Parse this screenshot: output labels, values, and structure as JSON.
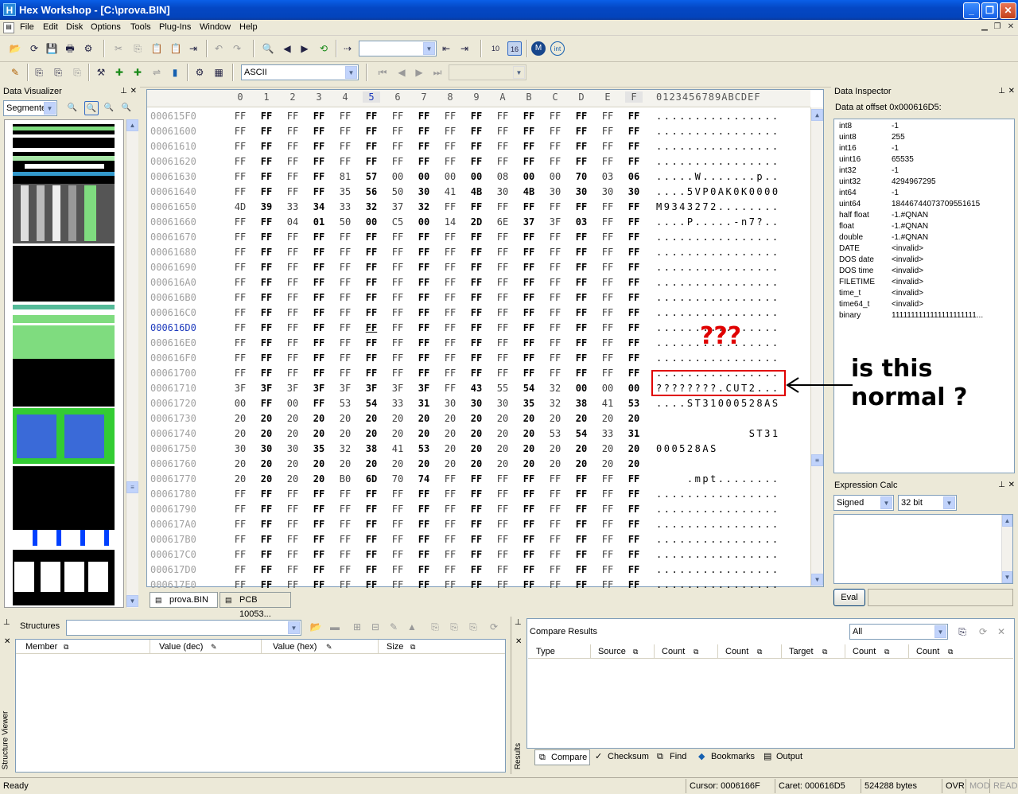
{
  "window": {
    "title": "Hex Workshop - [C:\\prova.BIN]",
    "app_icon": "H"
  },
  "menu": [
    "File",
    "Edit",
    "Disk",
    "Options",
    "Tools",
    "Plug-Ins",
    "Window",
    "Help"
  ],
  "toolbar": {
    "char_set": "ASCII"
  },
  "data_visualizer": {
    "title": "Data Visualizer",
    "mode": "Segmente"
  },
  "hex": {
    "col_headers": [
      "0",
      "1",
      "2",
      "3",
      "4",
      "5",
      "6",
      "7",
      "8",
      "9",
      "A",
      "B",
      "C",
      "D",
      "E",
      "F"
    ],
    "ascii_header": "0123456789ABCDEF",
    "rows": [
      {
        "addr": "000615F0",
        "b": "FF FF FF FF FF FF FF FF FF FF FF FF FF FF FF FF",
        "a": "................"
      },
      {
        "addr": "00061600",
        "b": "FF FF FF FF FF FF FF FF FF FF FF FF FF FF FF FF",
        "a": "................"
      },
      {
        "addr": "00061610",
        "b": "FF FF FF FF FF FF FF FF FF FF FF FF FF FF FF FF",
        "a": "................"
      },
      {
        "addr": "00061620",
        "b": "FF FF FF FF FF FF FF FF FF FF FF FF FF FF FF FF",
        "a": "................"
      },
      {
        "addr": "00061630",
        "b": "FF FF FF FF 81 57 00 00 00 00 08 00 00 70 03 06",
        "a": ".....W.......p.."
      },
      {
        "addr": "00061640",
        "b": "FF FF FF FF 35 56 50 30 41 4B 30 4B 30 30 30 30",
        "a": "....5VP0AK0K0000"
      },
      {
        "addr": "00061650",
        "b": "4D 39 33 34 33 32 37 32 FF FF FF FF FF FF FF FF",
        "a": "M9343272........"
      },
      {
        "addr": "00061660",
        "b": "FF FF 04 01 50 00 C5 00 14 2D 6E 37 3F 03 FF FF",
        "a": "....P.....-n7?.."
      },
      {
        "addr": "00061670",
        "b": "FF FF FF FF FF FF FF FF FF FF FF FF FF FF FF FF",
        "a": "................"
      },
      {
        "addr": "00061680",
        "b": "FF FF FF FF FF FF FF FF FF FF FF FF FF FF FF FF",
        "a": "................"
      },
      {
        "addr": "00061690",
        "b": "FF FF FF FF FF FF FF FF FF FF FF FF FF FF FF FF",
        "a": "................"
      },
      {
        "addr": "000616A0",
        "b": "FF FF FF FF FF FF FF FF FF FF FF FF FF FF FF FF",
        "a": "................"
      },
      {
        "addr": "000616B0",
        "b": "FF FF FF FF FF FF FF FF FF FF FF FF FF FF FF FF",
        "a": "................"
      },
      {
        "addr": "000616C0",
        "b": "FF FF FF FF FF FF FF FF FF FF FF FF FF FF FF FF",
        "a": "................"
      },
      {
        "addr": "000616D0",
        "b": "FF FF FF FF FF FF FF FF FF FF FF FF FF FF FF FF",
        "a": "................"
      },
      {
        "addr": "000616E0",
        "b": "FF FF FF FF FF FF FF FF FF FF FF FF FF FF FF FF",
        "a": "................"
      },
      {
        "addr": "000616F0",
        "b": "FF FF FF FF FF FF FF FF FF FF FF FF FF FF FF FF",
        "a": "................"
      },
      {
        "addr": "00061700",
        "b": "FF FF FF FF FF FF FF FF FF FF FF FF FF FF FF FF",
        "a": "................"
      },
      {
        "addr": "00061710",
        "b": "3F 3F 3F 3F 3F 3F 3F 3F FF 43 55 54 32 00 00 00",
        "a": "????????.CUT2..."
      },
      {
        "addr": "00061720",
        "b": "00 FF 00 FF 53 54 33 31 30 30 30 35 32 38 41 53",
        "a": "....ST31000528AS"
      },
      {
        "addr": "00061730",
        "b": "20 20 20 20 20 20 20 20 20 20 20 20 20 20 20 20",
        "a": "                "
      },
      {
        "addr": "00061740",
        "b": "20 20 20 20 20 20 20 20 20 20 20 20 53 54 33 31",
        "a": "            ST31"
      },
      {
        "addr": "00061750",
        "b": "30 30 30 35 32 38 41 53 20 20 20 20 20 20 20 20",
        "a": "000528AS        "
      },
      {
        "addr": "00061760",
        "b": "20 20 20 20 20 20 20 20 20 20 20 20 20 20 20 20",
        "a": "                "
      },
      {
        "addr": "00061770",
        "b": "20 20 20 20 B0 6D 70 74 FF FF FF FF FF FF FF FF",
        "a": "    .mpt........"
      },
      {
        "addr": "00061780",
        "b": "FF FF FF FF FF FF FF FF FF FF FF FF FF FF FF FF",
        "a": "................"
      },
      {
        "addr": "00061790",
        "b": "FF FF FF FF FF FF FF FF FF FF FF FF FF FF FF FF",
        "a": "................"
      },
      {
        "addr": "000617A0",
        "b": "FF FF FF FF FF FF FF FF FF FF FF FF FF FF FF FF",
        "a": "................"
      },
      {
        "addr": "000617B0",
        "b": "FF FF FF FF FF FF FF FF FF FF FF FF FF FF FF FF",
        "a": "................"
      },
      {
        "addr": "000617C0",
        "b": "FF FF FF FF FF FF FF FF FF FF FF FF FF FF FF FF",
        "a": "................"
      },
      {
        "addr": "000617D0",
        "b": "FF FF FF FF FF FF FF FF FF FF FF FF FF FF FF FF",
        "a": "................"
      },
      {
        "addr": "000617E0",
        "b": "FF FF FF FF FF FF FF FF FF FF FF FF FF FF FF FF",
        "a": "................"
      }
    ]
  },
  "tabs": [
    "prova.BIN",
    "PCB 10053..."
  ],
  "data_inspector": {
    "title": "Data Inspector",
    "offset_label": "Data at offset 0x000616D5:",
    "rows": [
      [
        "int8",
        "-1"
      ],
      [
        "uint8",
        "255"
      ],
      [
        "int16",
        "-1"
      ],
      [
        "uint16",
        "65535"
      ],
      [
        "int32",
        "-1"
      ],
      [
        "uint32",
        "4294967295"
      ],
      [
        "int64",
        "-1"
      ],
      [
        "uint64",
        "18446744073709551615"
      ],
      [
        "half float",
        "-1.#QNAN"
      ],
      [
        "float",
        "-1.#QNAN"
      ],
      [
        "double",
        "-1.#QNAN"
      ],
      [
        "DATE",
        "<invalid>"
      ],
      [
        "DOS date",
        "<invalid>"
      ],
      [
        "DOS time",
        "<invalid>"
      ],
      [
        "FILETIME",
        "<invalid>"
      ],
      [
        "time_t",
        "<invalid>"
      ],
      [
        "time64_t",
        "<invalid>"
      ],
      [
        "binary",
        "1111111111111111111111..."
      ]
    ]
  },
  "expression_calc": {
    "title": "Expression Calc",
    "sign": "Signed",
    "bits": "32 bit",
    "eval": "Eval"
  },
  "structures": {
    "title": "Structures",
    "cols": [
      "Member",
      "Value (dec)",
      "Value (hex)",
      "Size"
    ],
    "side": "Structure Viewer"
  },
  "compare": {
    "title": "Compare Results",
    "filter": "All",
    "cols": [
      "Type",
      "Source",
      "Count",
      "Count",
      "Target",
      "Count",
      "Count"
    ],
    "side": "Results",
    "bottom_tabs": [
      "Compare",
      "Checksum",
      "Find",
      "Bookmarks",
      "Output"
    ]
  },
  "status": {
    "ready": "Ready",
    "cursor": "Cursor: 0006166F",
    "caret": "Caret: 000616D5",
    "size": "524288 bytes",
    "ovr": "OVR",
    "mod": "MOD",
    "read": "READ"
  },
  "annotation": {
    "qqq": "???",
    "question": "is this\nnormal ?"
  }
}
